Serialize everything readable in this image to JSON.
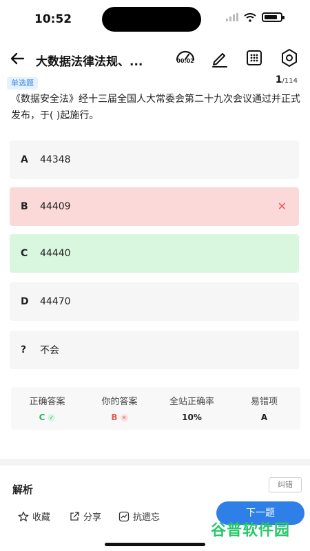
{
  "status_bar": {
    "time": "10:52"
  },
  "header": {
    "title": "大数据法律法规、...",
    "timer": "00:02"
  },
  "question": {
    "type_tag": "单选题",
    "current": "1",
    "total": "/114",
    "text": "《数据安全法》经十三届全国人大常委会第二十九次会议通过并正式发布，于( )起施行。"
  },
  "options": [
    {
      "letter": "A",
      "text": "44348",
      "state": "normal"
    },
    {
      "letter": "B",
      "text": "44409",
      "state": "wrong"
    },
    {
      "letter": "C",
      "text": "44440",
      "state": "right"
    },
    {
      "letter": "D",
      "text": "44470",
      "state": "normal"
    },
    {
      "letter": "?",
      "text": "不会",
      "state": "normal"
    }
  ],
  "stats": {
    "correct_label": "正确答案",
    "correct_value": "C",
    "yours_label": "你的答案",
    "yours_value": "B",
    "rate_label": "全站正确率",
    "rate_value": "10%",
    "mistake_label": "易错项",
    "mistake_value": "A"
  },
  "analysis": {
    "title": "解析",
    "report": "纠错"
  },
  "bottom": {
    "favorite": "收藏",
    "share": "分享",
    "forget": "抗遗忘",
    "next": "下一题"
  },
  "watermark": "谷普软件园",
  "colors": {
    "accent": "#2f7fe8",
    "wrong": "#fbd9d8",
    "right": "#d9f7df"
  }
}
